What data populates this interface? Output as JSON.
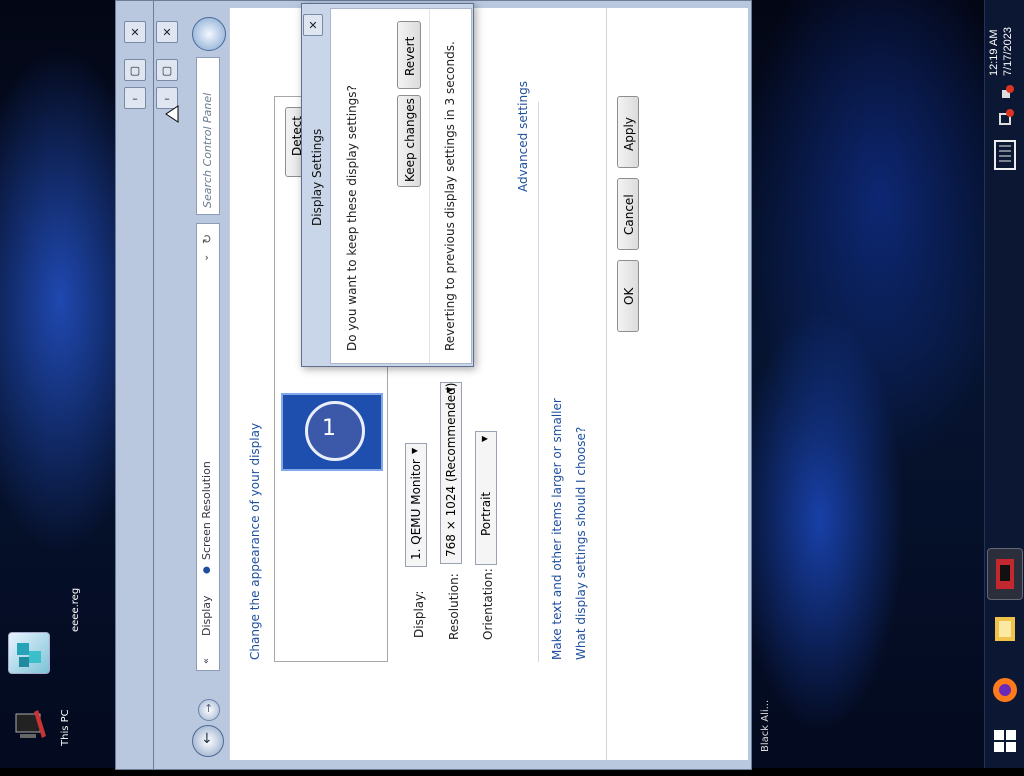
{
  "taskbar": {
    "time": "12:19 AM",
    "date": "7/17/2023",
    "icons": [
      "keyboard-icon",
      "network-warning-icon",
      "volume-muted-icon",
      "app-icon",
      "folder-icon",
      "firefox-icon",
      "start-icon"
    ]
  },
  "desktop": {
    "icons": [
      {
        "label": "eeee.reg",
        "icon": "registry-file-icon"
      },
      {
        "label": "This PC",
        "icon": "this-pc-icon"
      }
    ],
    "bottom_text": "Black Ali..."
  },
  "control_panel": {
    "breadcrumb": [
      "Display",
      "Screen Resolution"
    ],
    "search_placeholder": "Search Control Panel",
    "heading": "Change the appearance of your display",
    "detect_button": "Detect",
    "display_label": "Display:",
    "display_value": "1. QEMU Monitor",
    "resolution_label": "Resolution:",
    "resolution_value": "768 × 1024 (Recommended)",
    "orientation_label": "Orientation:",
    "orientation_value": "Portrait",
    "advanced_link": "Advanced settings",
    "link_text_size": "Make text and other items larger or smaller",
    "link_what_settings": "What display settings should I choose?",
    "ok_button": "OK",
    "cancel_button": "Cancel",
    "apply_button": "Apply",
    "monitor_number": "1"
  },
  "dialog": {
    "title": "Display Settings",
    "question": "Do you want to keep these display settings?",
    "countdown": "Reverting to previous display settings in 3 seconds.",
    "keep_button": "Keep changes",
    "revert_button": "Revert"
  }
}
